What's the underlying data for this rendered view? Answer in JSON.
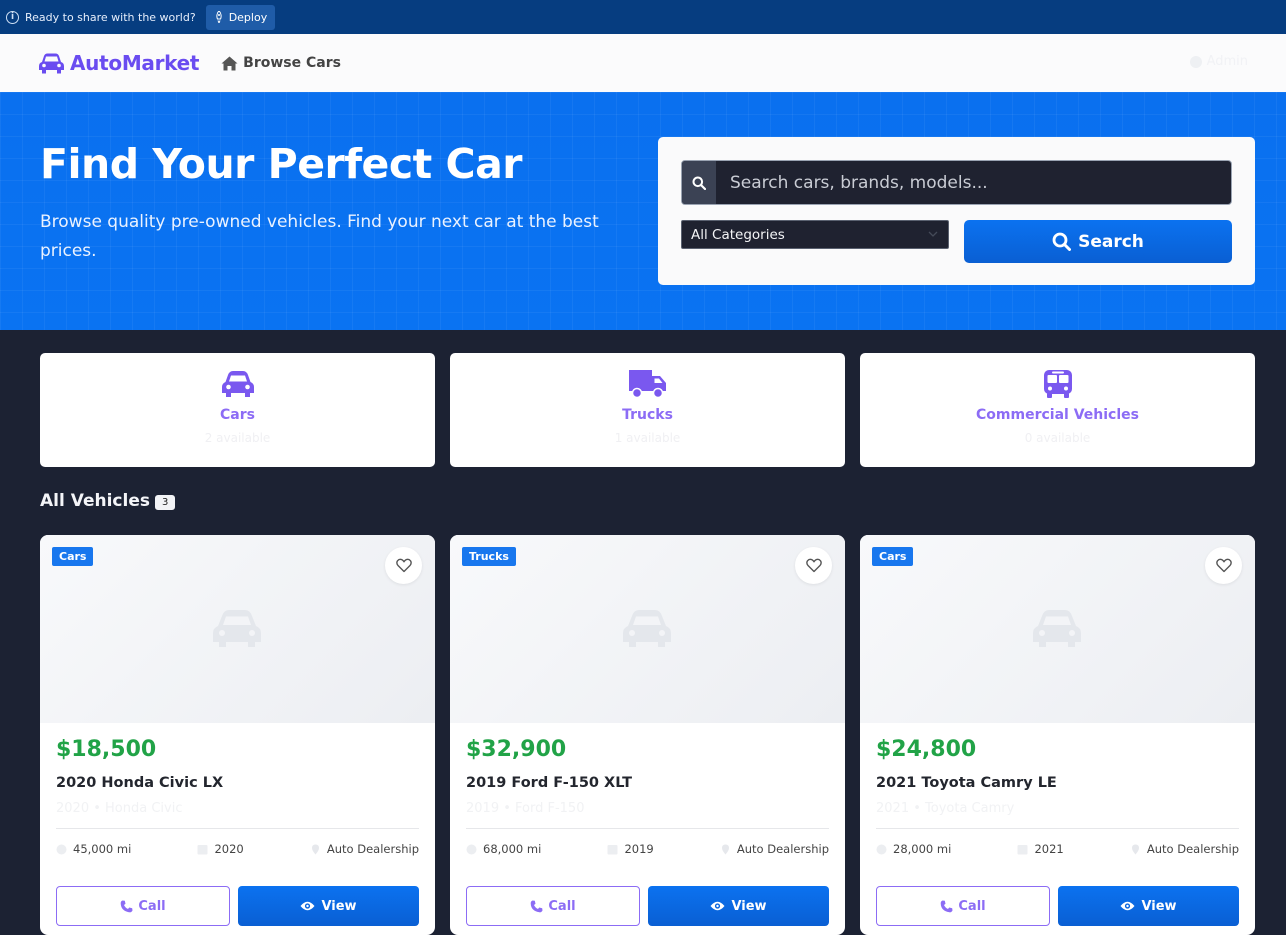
{
  "banner": {
    "text": "Ready to share with the world?",
    "deploy_label": "Deploy"
  },
  "navbar": {
    "brand": "AutoMarket",
    "browse_label": "Browse Cars",
    "admin_label": "Admin"
  },
  "hero": {
    "title": "Find Your Perfect Car",
    "subtitle": "Browse quality pre-owned vehicles. Find your next car at the best prices.",
    "search_placeholder": "Search cars, brands, models...",
    "category_selected": "All Categories",
    "search_button": "Search"
  },
  "categories": [
    {
      "name": "Cars",
      "count": "2 available",
      "icon": "car-icon"
    },
    {
      "name": "Trucks",
      "count": "1 available",
      "icon": "truck-icon"
    },
    {
      "name": "Commercial Vehicles",
      "count": "0 available",
      "icon": "bus-icon"
    }
  ],
  "section": {
    "title": "All Vehicles",
    "count": "3"
  },
  "vehicles": [
    {
      "badge": "Cars",
      "price": "$18,500",
      "title": "2020 Honda Civic LX",
      "subtitle": "2020 • Honda Civic",
      "mileage": "45,000 mi",
      "year": "2020",
      "seller": "Auto Dealership",
      "call_label": "Call",
      "view_label": "View"
    },
    {
      "badge": "Trucks",
      "price": "$32,900",
      "title": "2019 Ford F-150 XLT",
      "subtitle": "2019 • Ford F-150",
      "mileage": "68,000 mi",
      "year": "2019",
      "seller": "Auto Dealership",
      "call_label": "Call",
      "view_label": "View"
    },
    {
      "badge": "Cars",
      "price": "$24,800",
      "title": "2021 Toyota Camry LE",
      "subtitle": "2021 • Toyota Camry",
      "mileage": "28,000 mi",
      "year": "2021",
      "seller": "Auto Dealership",
      "call_label": "Call",
      "view_label": "View"
    }
  ],
  "colors": {
    "brand": "#6a4cf0",
    "accent": "#0b72f0",
    "price": "#21a347",
    "category": "#8c6cf5"
  }
}
